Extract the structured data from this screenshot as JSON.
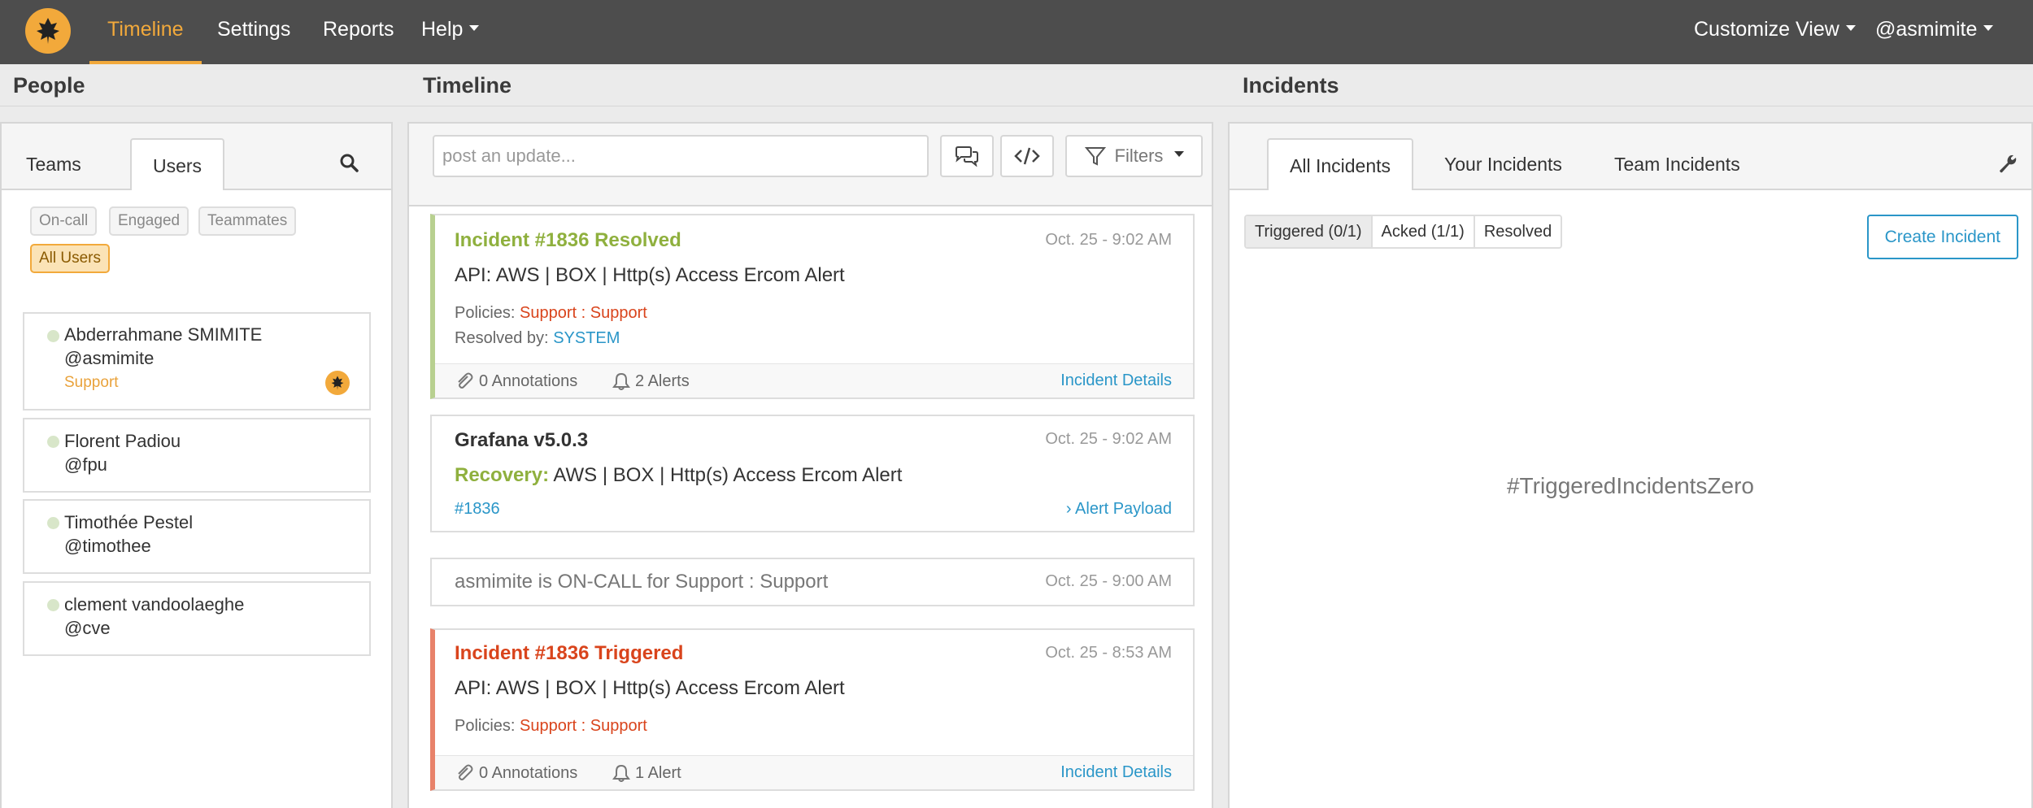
{
  "nav": {
    "items": [
      "Timeline",
      "Settings",
      "Reports",
      "Help"
    ],
    "customize": "Customize View",
    "user": "@asmimite"
  },
  "sections": {
    "people": "People",
    "timeline": "Timeline",
    "incidents": "Incidents"
  },
  "people": {
    "tabs": [
      "Teams",
      "Users"
    ],
    "filters": [
      "On-call",
      "Engaged",
      "Teammates",
      "All Users"
    ],
    "users": [
      {
        "name": "Abderrahmane SMIMITE",
        "handle": "@asmimite",
        "team": "Support"
      },
      {
        "name": "Florent Padiou",
        "handle": "@fpu"
      },
      {
        "name": "Timothée Pestel",
        "handle": "@timothee"
      },
      {
        "name": "clement vandoolaeghe",
        "handle": "@cve"
      }
    ]
  },
  "timeline": {
    "post_placeholder": "post an update...",
    "filters_label": "Filters",
    "cards": [
      {
        "title": "Incident #1836 Resolved",
        "date": "Oct. 25 - 9:02 AM",
        "body": "API: AWS | BOX | Http(s) Access Ercom Alert",
        "policies_label": "Policies:",
        "policies_value": "Support : Support",
        "resolved_label": "Resolved by:",
        "resolved_value": "SYSTEM",
        "annotations": "0 Annotations",
        "alerts": "2 Alerts",
        "details": "Incident Details"
      },
      {
        "title": "Grafana v5.0.3",
        "date": "Oct. 25 - 9:02 AM",
        "recovery_label": "Recovery:",
        "body": "AWS | BOX | Http(s) Access Ercom Alert",
        "link": "#1836",
        "payload": "Alert Payload"
      },
      {
        "text": "asmimite is ON-CALL for Support : Support",
        "date": "Oct. 25 - 9:00 AM"
      },
      {
        "title": "Incident #1836 Triggered",
        "date": "Oct. 25 - 8:53 AM",
        "body": "API: AWS | BOX | Http(s) Access Ercom Alert",
        "policies_label": "Policies:",
        "policies_value": "Support : Support",
        "annotations": "0 Annotations",
        "alerts": "1 Alert",
        "details": "Incident Details"
      }
    ]
  },
  "incidents": {
    "tabs": [
      "All Incidents",
      "Your Incidents",
      "Team Incidents"
    ],
    "segments": [
      "Triggered (0/1)",
      "Acked (1/1)",
      "Resolved"
    ],
    "create": "Create Incident",
    "zero": "#TriggeredIncidentsZero"
  },
  "colors": {
    "brand": "#f2a93b",
    "nav_bg": "#4d4d4d",
    "resolved": "#8fb03e",
    "triggered": "#d9441c",
    "link": "#2a96c8"
  }
}
